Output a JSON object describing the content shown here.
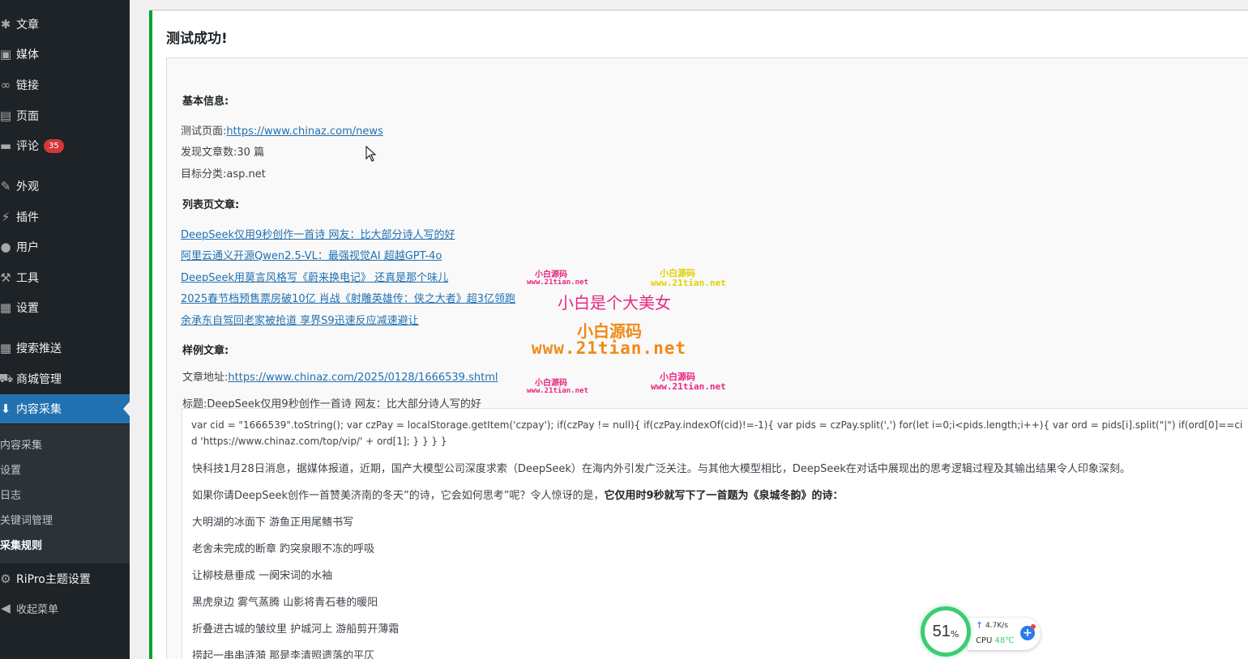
{
  "sidebar": {
    "items": [
      {
        "label": "文章",
        "icon": "pin-icon"
      },
      {
        "label": "媒体",
        "icon": "media-icon"
      },
      {
        "label": "链接",
        "icon": "link-icon"
      },
      {
        "label": "页面",
        "icon": "page-icon"
      },
      {
        "label": "评论",
        "icon": "comment-icon",
        "badge": "35"
      },
      {
        "label": "外观",
        "icon": "brush-icon"
      },
      {
        "label": "插件",
        "icon": "plugin-icon"
      },
      {
        "label": "用户",
        "icon": "user-icon"
      },
      {
        "label": "工具",
        "icon": "wrench-icon"
      },
      {
        "label": "设置",
        "icon": "settings-icon"
      },
      {
        "label": "搜索推送",
        "icon": "push-icon"
      },
      {
        "label": "商城管理",
        "icon": "cart-icon"
      },
      {
        "label": "内容采集",
        "icon": "collect-icon",
        "active": true
      },
      {
        "label": "RiPro主题设置",
        "icon": "gear-icon"
      },
      {
        "label": "收起菜单",
        "icon": "collapse-icon"
      }
    ],
    "submenu": [
      {
        "label": "内容采集"
      },
      {
        "label": "设置"
      },
      {
        "label": "日志"
      },
      {
        "label": "关键词管理"
      },
      {
        "label": "采集规则",
        "current": true
      }
    ]
  },
  "notice": {
    "title": "测试成功!",
    "basic_title": "基本信息:",
    "test_page_label": "测试页面:",
    "test_page_url": "https://www.chinaz.com/news",
    "found_label": "发现文章数:",
    "found_value": "30 篇",
    "category_label": "目标分类:",
    "category_value": "asp.net",
    "list_title": "列表页文章:",
    "articles": [
      "DeepSeek仅用9秒创作一首诗 网友：比大部分诗人写的好",
      "阿里云通义开源Qwen2.5-VL：最强视觉AI 超越GPT-4o",
      "DeepSeek用莫言风格写《蔚来换电记》 还真是那个味儿",
      "2025春节档预售票房破10亿 肖战《射雕英雄传：侠之大者》超3亿领跑",
      "余承东自驾回老家被抢道 享界S9迅速反应减速避让"
    ],
    "sample_title": "样例文章:",
    "article_url_label": "文章地址:",
    "article_url": "https://www.chinaz.com/2025/0128/1666539.shtml",
    "headline_label": "标题:",
    "headline": "DeepSeek仅用9秒创作一首诗 网友：比大部分诗人写的好",
    "script_text": "var cid = \"1666539\".toString(); var czPay = localStorage.getItem('czpay'); if(czPay != null){ if(czPay.indexOf(cid)!=-1){ var pids = czPay.split(',') for(let i=0;i<pids.length;i++){ var ord = pids[i].split(\"|\") if(ord[0]==cid 'https://www.chinaz.com/top/vip/' + ord[1]; } } } }",
    "para1": "快科技1月28日消息，据媒体报道，近期，国产大模型公司深度求索（DeepSeek）在海内外引发广泛关注。与其他大模型相比，DeepSeek在对话中展现出的思考逻辑过程及其输出结果令人印象深刻。",
    "para2_normal": "如果你请DeepSeek创作一首赞美济南的冬天”的诗，它会如何思考”呢？令人惊讶的是，",
    "para2_bold": "它仅用时9秒就写下了一首题为《泉城冬韵》的诗：",
    "poem": [
      "大明湖的冰面下 游鱼正用尾鳍书写",
      "老舍未完成的断章 趵突泉眼不冻的呼吸",
      "让柳枝悬垂成 一阕宋词的水袖",
      "黑虎泉边 雾气蒸腾 山影将青石巷的暖阳",
      "折叠进古城的皱纹里 护城河上 游船剪开薄霜",
      "捞起一串串涟漪 那是李清照遗落的平仄"
    ]
  },
  "watermark": {
    "small_pink": "小白源码",
    "small_pink_url": "www.21tian.net",
    "small_yellow": "小白源码",
    "small_yellow_url": "www.21tian.net",
    "big_pink": "小白是个大美女",
    "big_orange": "小白源码",
    "big_orange_url": "www.21tian.net"
  },
  "cpu_widget": {
    "percent": "51",
    "percent_sign": "%",
    "speed": "4.7K/s",
    "cpu_label": "CPU",
    "temp": "48℃"
  },
  "colors": {
    "sidebar_bg": "#1d2327",
    "active_bg": "#2271b1",
    "notice_border": "#00a32a",
    "link": "#2271b1",
    "badge": "#d63638"
  }
}
